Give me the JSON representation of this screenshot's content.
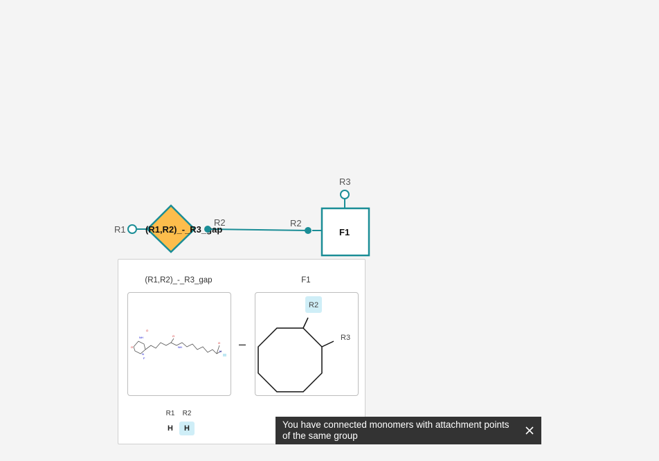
{
  "canvas": {
    "monomer1": {
      "label": "(R1,R2)_-_R3_gap",
      "fill_color": "#fdbd4c",
      "border_color": "#1a8d96",
      "attachment_points": [
        "R1",
        "R2"
      ]
    },
    "monomer2": {
      "label": "F1",
      "border_color": "#1a8d96",
      "attachment_points": [
        "R2",
        "R3"
      ]
    }
  },
  "preview": {
    "left_title": "(R1,R2)_-_R3_gap",
    "right_title": "F1",
    "separator": "–",
    "right_structure_labels": {
      "r2": "R2",
      "r3": "R3"
    },
    "left_attachment_points": [
      {
        "name": "R1",
        "atom": "H",
        "highlighted": false
      },
      {
        "name": "R2",
        "atom": "H",
        "highlighted": true
      }
    ]
  },
  "toast": {
    "message": "You have connected monomers with attachment points of the same group",
    "icon": "close-icon"
  }
}
